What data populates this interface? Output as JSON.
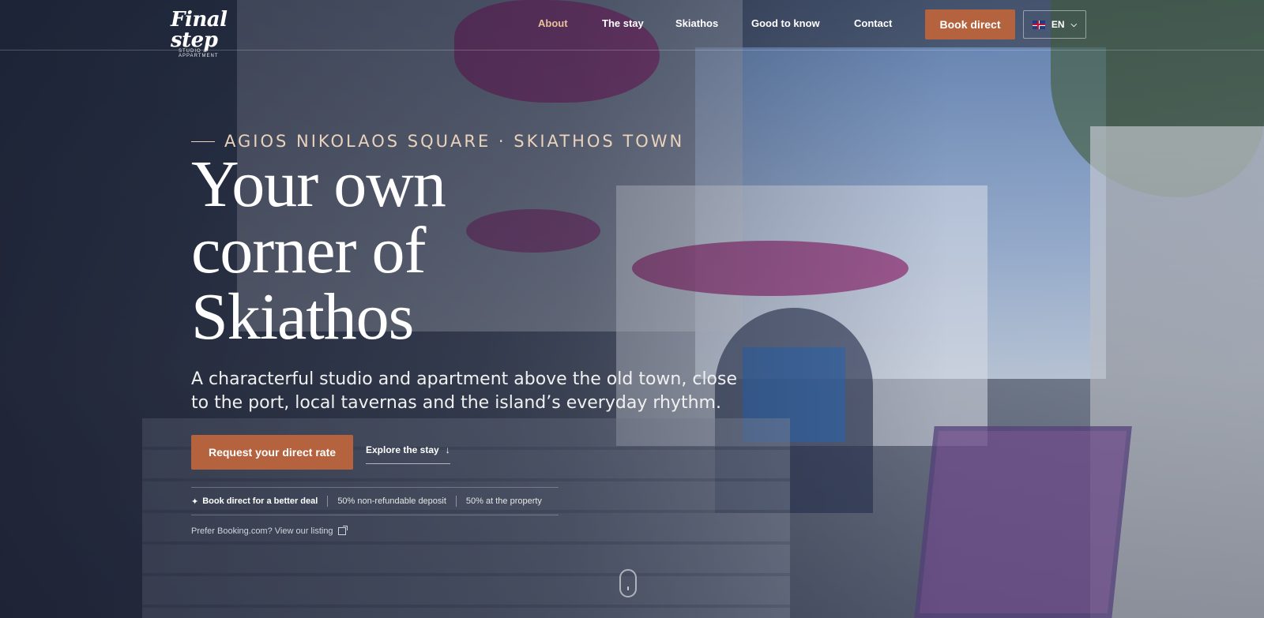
{
  "header": {
    "logo_text": "Final step",
    "logo_sub": "STUDIO & APPARTMENT",
    "nav": [
      {
        "label": "About",
        "active": true
      },
      {
        "label": "The stay",
        "active": false
      },
      {
        "label": "Skiathos",
        "active": false
      },
      {
        "label": "Good to know",
        "active": false
      },
      {
        "label": "Contact",
        "active": false
      }
    ],
    "book_label": "Book direct",
    "lang": "EN"
  },
  "hero": {
    "eyebrow": "AGIOS NIKOLAOS SQUARE · SKIATHOS TOWN",
    "headline": [
      "Your own",
      "corner of",
      "Skiathos"
    ],
    "subtitle": "A characterful studio and apartment above the old town, close to the port, local tavernas and the island’s everyday rhythm.",
    "cta_label": "Request your direct rate",
    "explore_label": "Explore the stay",
    "trust": [
      "Book direct for a better deal",
      "50% non-refundable deposit",
      "50% at the property"
    ],
    "booking_link": "Prefer Booking.com? View our listing"
  },
  "colors": {
    "accent": "#b5633e",
    "eyebrow": "#ead3bd",
    "active_nav": "#e9c09c"
  },
  "icons": {
    "sparkle": "sparkle-icon",
    "arrow": "arrow-down-icon",
    "external": "external-link-icon",
    "chevron": "chevron-down-icon",
    "flag": "uk-flag-icon"
  }
}
